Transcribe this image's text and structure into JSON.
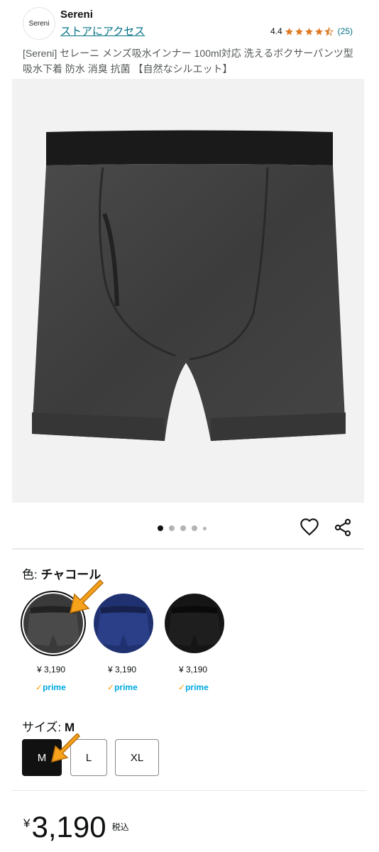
{
  "header": {
    "logo_text": "Sereni",
    "brand": "Sereni",
    "store_link": "ストアにアクセス",
    "rating_value": "4.4",
    "rating_count": "(25)",
    "rating_stars": 4.5,
    "title": "[Sereni] セレーニ メンズ吸水インナー 100ml対応 洗えるボクサーパンツ型 吸水下着 防水 消臭 抗菌 【自然なシルエット】"
  },
  "gallery": {
    "image_icon": "boxer-briefs-product-image",
    "dots_count": 5,
    "active_dot": 0
  },
  "color": {
    "label": "色: ",
    "selected": "チャコール",
    "options": [
      {
        "price": "¥ 3,190",
        "prime": "prime",
        "color": "#3a3a3a"
      },
      {
        "price": "¥ 3,190",
        "prime": "prime",
        "color": "#1f3170"
      },
      {
        "price": "¥ 3,190",
        "prime": "prime",
        "color": "#151515"
      }
    ]
  },
  "size": {
    "label": "サイズ: ",
    "selected": "M",
    "options": [
      "M",
      "L",
      "XL"
    ]
  },
  "price": {
    "yen": "¥",
    "amount": "3,190",
    "tax": "税込"
  },
  "colors": {
    "link": "#007185",
    "star": "#de7921",
    "arrow": "#f7a21b"
  }
}
